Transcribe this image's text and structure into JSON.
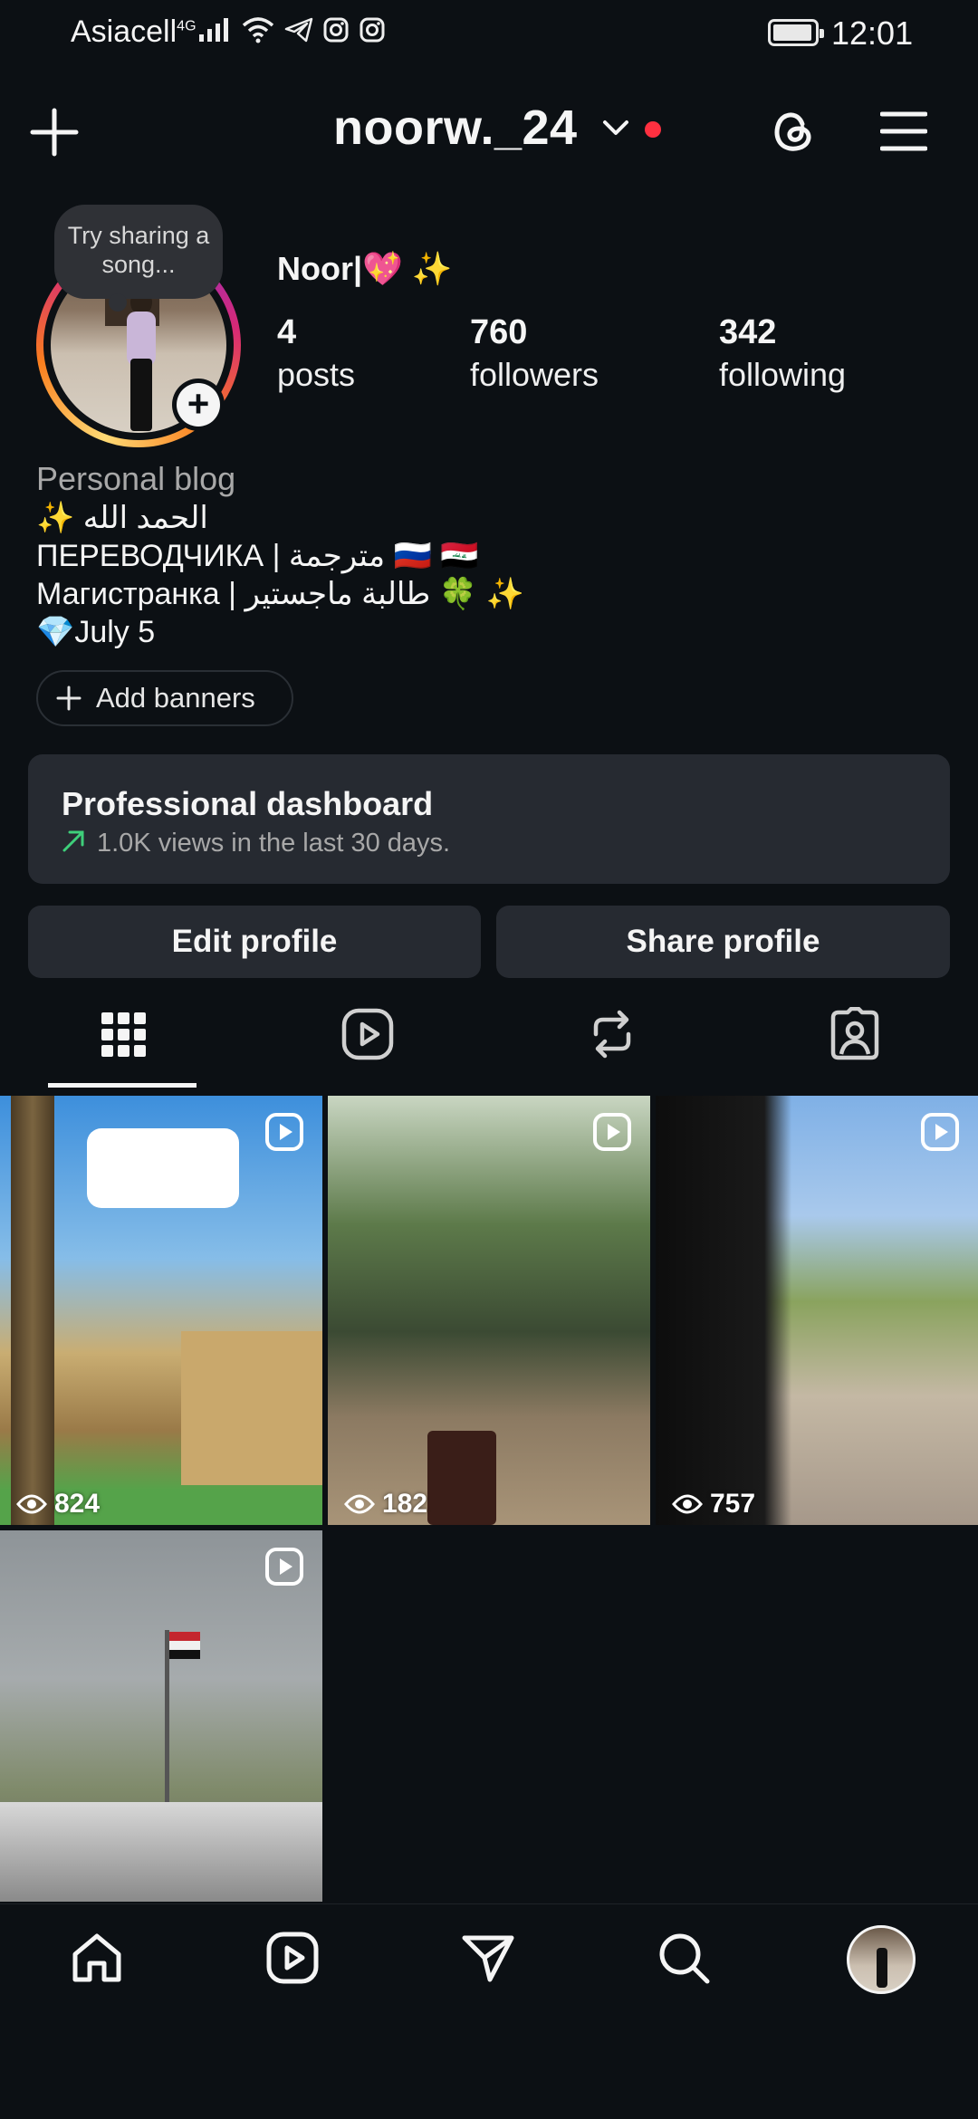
{
  "status_bar": {
    "carrier": "Asiacell",
    "network": "4G",
    "time": "12:01"
  },
  "header": {
    "username": "noorw._24"
  },
  "profile": {
    "note": "Try sharing a song...",
    "display_name": "Noor|💖 ✨",
    "stats": [
      {
        "value": "4",
        "label": "posts"
      },
      {
        "value": "760",
        "label": "followers"
      },
      {
        "value": "342",
        "label": "following"
      }
    ],
    "category": "Personal blog",
    "bio": [
      "✨ الحمد الله",
      "ПЕРЕВОДЧИКА | مترجمة 🇷🇺 🇮🇶",
      "Магистранка |  طالبة ماجستير 🍀 ✨",
      "💎July 5"
    ],
    "add_banners": "Add banners"
  },
  "dashboard": {
    "title": "Professional dashboard",
    "subtitle": "1.0K views in the last 30 days."
  },
  "actions": {
    "edit": "Edit profile",
    "share": "Share profile"
  },
  "tabs": [
    "grid-icon",
    "reels-icon",
    "reposts-icon",
    "tagged-icon"
  ],
  "posts": [
    {
      "views": "824",
      "caption": ""
    },
    {
      "views": "182",
      "caption": ""
    },
    {
      "views": "757",
      "caption": ""
    },
    {
      "views": "",
      "caption": ""
    }
  ],
  "bottom_nav": [
    "home-icon",
    "reels-icon",
    "messages-icon",
    "search-icon",
    "profile-avatar"
  ]
}
